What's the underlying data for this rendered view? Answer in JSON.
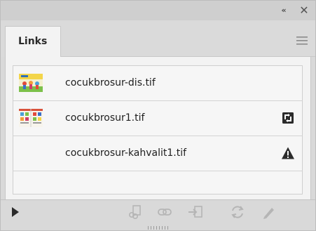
{
  "panel": {
    "tab_label": "Links",
    "collapse_glyph": "«",
    "close_glyph": "✕"
  },
  "links": [
    {
      "name": "cocukbrosur-dis.tif",
      "thumb": "cover-thumb",
      "status": "none"
    },
    {
      "name": "cocukbrosur1.tif",
      "thumb": "spread-thumb",
      "status": "modified-icon"
    },
    {
      "name": "cocukbrosur-kahvalit1.tif",
      "thumb": "none",
      "status": "missing-warning-icon"
    }
  ],
  "toolbar": {
    "icons": [
      "relink-from-folder-icon",
      "relink-icon",
      "go-to-link-icon",
      "update-link-icon",
      "edit-original-icon"
    ]
  },
  "colors": {
    "panel_bg": "#d9d9d9",
    "list_bg": "#f6f6f6",
    "text": "#1e1e1e",
    "disabled_icon": "#b5b5b5"
  }
}
